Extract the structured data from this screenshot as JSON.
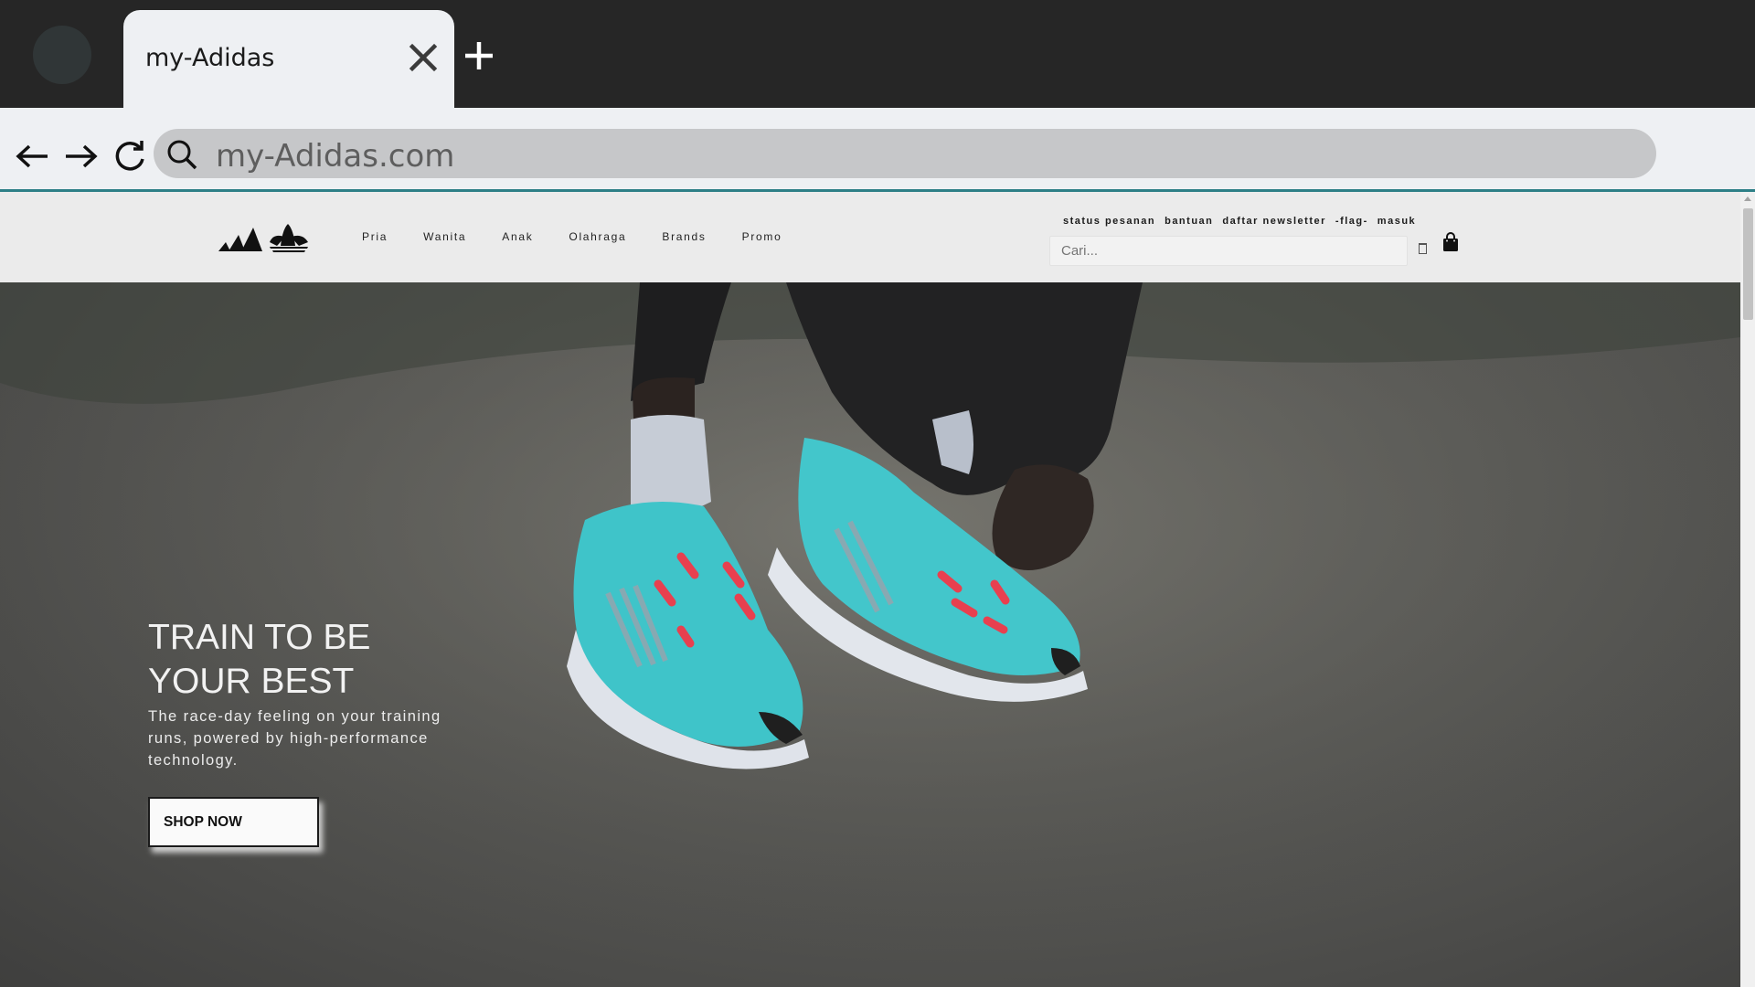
{
  "browser": {
    "tab_title": "my-Adidas",
    "url": "my-Adidas.com",
    "icons": [
      "back-arrow-icon",
      "forward-arrow-icon",
      "reload-icon",
      "search-icon",
      "close-icon",
      "plus-icon"
    ]
  },
  "header": {
    "nav": [
      {
        "label": "Pria"
      },
      {
        "label": "Wanita"
      },
      {
        "label": "Anak"
      },
      {
        "label": "Olahraga"
      },
      {
        "label": "Brands"
      },
      {
        "label": "Promo"
      }
    ],
    "utility_links": [
      {
        "label": "status pesanan"
      },
      {
        "label": "bantuan"
      },
      {
        "label": "daftar newsletter"
      },
      {
        "label": "-flag-"
      },
      {
        "label": "masuk"
      }
    ],
    "search_placeholder": "Cari..."
  },
  "hero": {
    "heading_line1": "TRAIN TO BE",
    "heading_line2": "YOUR BEST",
    "subtext": "The race-day feeling on your training runs, powered by high-performance technology.",
    "cta_label": "SHOP NOW"
  },
  "colors": {
    "chrome_dark": "#262626",
    "chrome_light": "#eef0f3",
    "accent_line": "#2d7f86",
    "shoe_teal": "#3fc4c9",
    "lace_red": "#e8404f"
  }
}
